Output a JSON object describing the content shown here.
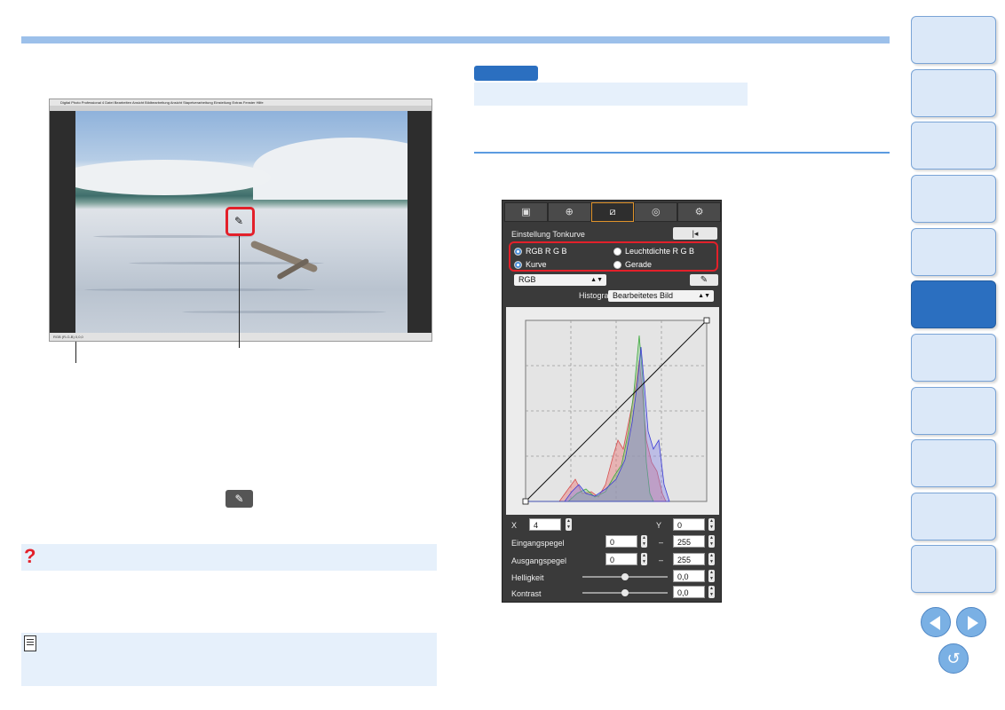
{
  "app_screenshot": {
    "menubar_text": "Digital Photo Professional 4  Datei  Bearbeiten  Ansicht  Bildbearbeitung  Ansicht  Stapelverarbeitung  Einstellung  Extras  Fenster  Hilfe",
    "status_text": "RGB   (R-G-B)   0,0,0"
  },
  "tone_curve_panel": {
    "tabs": [
      "▣",
      "⊕",
      "⧄",
      "◎",
      "⚙"
    ],
    "active_tab": 2,
    "title": "Einstellung Tonkurve",
    "reset_icon": "|◂",
    "radio_rgb": "RGB R G B",
    "radio_luminance": "Leuchtdichte R G B",
    "radio_curve": "Kurve",
    "radio_straight": "Gerade",
    "channel_select": "RGB",
    "histogram_label": "Histogramm",
    "histogram_select": "Bearbeitetes Bild",
    "x_label": "X",
    "x_value": "4",
    "y_label": "Y",
    "y_value": "0",
    "input_level_label": "Eingangspegel",
    "input_min": "0",
    "input_max": "255",
    "output_level_label": "Ausgangspegel",
    "output_min": "0",
    "output_max": "255",
    "brightness_label": "Helligkeit",
    "brightness_value": "0,0",
    "brightness_level": 0.5,
    "contrast_label": "Kontrast",
    "contrast_value": "0,0",
    "contrast_level": 0.5,
    "dash": "–",
    "eyedropper_icon": "✎"
  },
  "icons": {
    "eyedropper_button": "✎",
    "question_icon": "?"
  },
  "colors": {
    "accent_blue": "#2b6fc0",
    "highlight_red": "#e3202a",
    "light_band": "#e6f0fb"
  }
}
